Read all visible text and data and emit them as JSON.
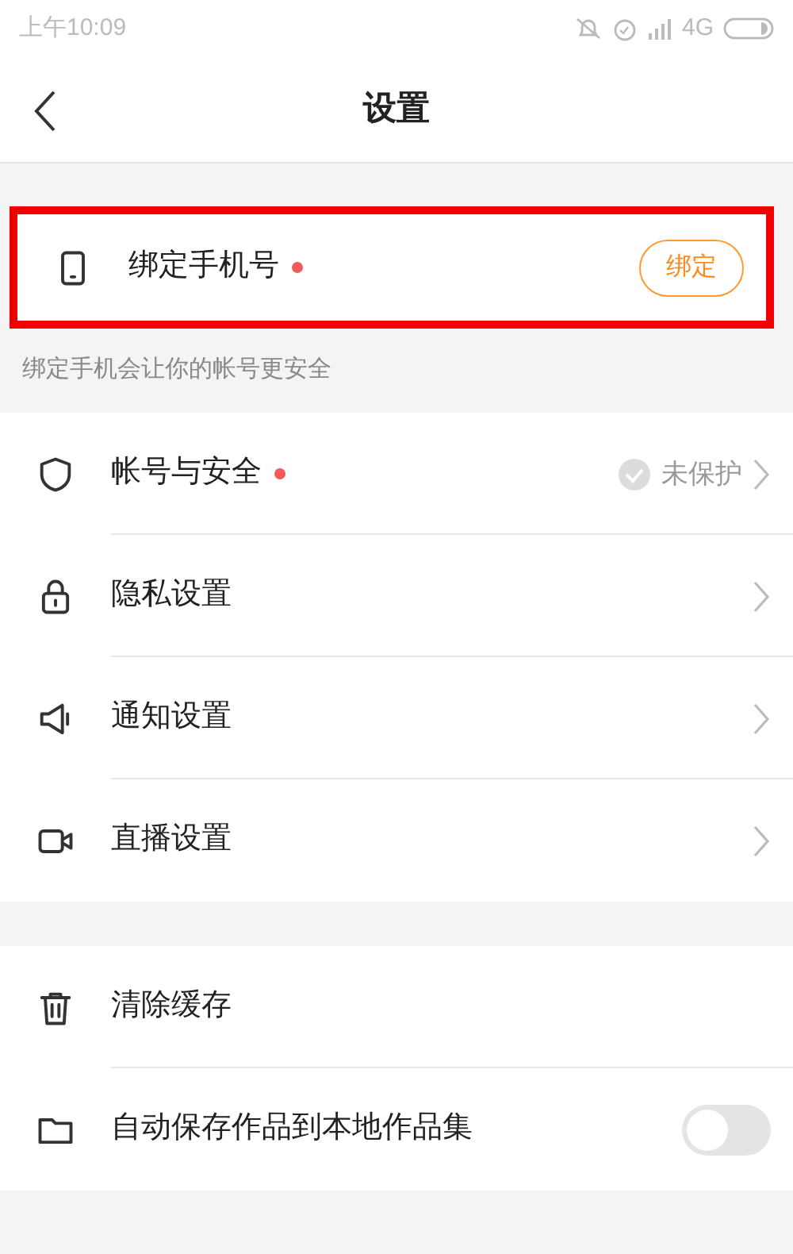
{
  "status_bar": {
    "time": "上午10:09",
    "network": "4G"
  },
  "header": {
    "title": "设置"
  },
  "bind_phone": {
    "label": "绑定手机号",
    "dot": true,
    "button": "绑定",
    "highlighted": true
  },
  "bind_hint": "绑定手机会让你的帐号更安全",
  "groups": [
    {
      "items": [
        {
          "label": "帐号与安全",
          "dot": true,
          "status": "未保护",
          "kind": "link"
        },
        {
          "label": "隐私设置",
          "dot": false,
          "kind": "link"
        },
        {
          "label": "通知设置",
          "dot": false,
          "kind": "link"
        },
        {
          "label": "直播设置",
          "dot": false,
          "kind": "link"
        }
      ]
    },
    {
      "items": [
        {
          "label": "清除缓存",
          "dot": false,
          "kind": "plain"
        },
        {
          "label": "自动保存作品到本地作品集",
          "dot": false,
          "kind": "toggle",
          "on": false
        }
      ]
    }
  ]
}
